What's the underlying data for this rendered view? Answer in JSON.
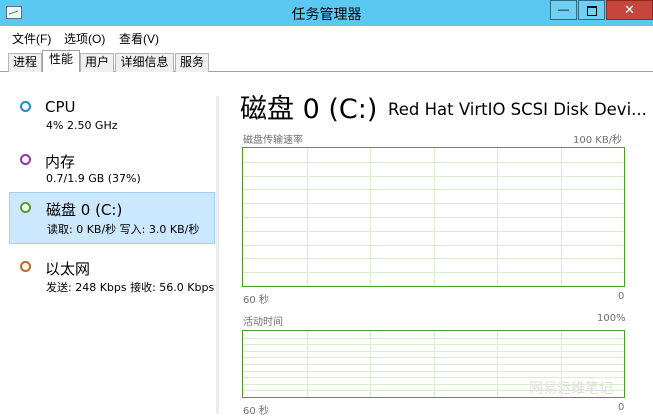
{
  "window": {
    "title": "任务管理器",
    "minimize_glyph": "—",
    "close_glyph": "✕"
  },
  "menu": [
    "文件(F)",
    "选项(O)",
    "查看(V)"
  ],
  "tabs": [
    {
      "label": "进程",
      "active": false
    },
    {
      "label": "性能",
      "active": true
    },
    {
      "label": "用户",
      "active": false
    },
    {
      "label": "详细信息",
      "active": false
    },
    {
      "label": "服务",
      "active": false
    }
  ],
  "resources": [
    {
      "name": "CPU",
      "detail": "4%  2.50 GHz",
      "color": "#1a8fd0",
      "selected": false
    },
    {
      "name": "内存",
      "detail": "0.7/1.9 GB (37%)",
      "color": "#9b2fae",
      "selected": false
    },
    {
      "name": "磁盘 0 (C:)",
      "detail": "读取: 0 KB/秒  写入: 3.0 KB/秒",
      "color": "#4d9e29",
      "selected": true
    },
    {
      "name": "以太网",
      "detail": "发送: 248 Kbps  接收: 56.0 Kbps",
      "color": "#c8651b",
      "selected": false
    }
  ],
  "detail": {
    "title": "磁盘 0 (C:)",
    "device": "Red Hat VirtIO SCSI Disk Devi...",
    "transfer_chart": {
      "label": "磁盘传输速率",
      "max_label": "100 KB/秒",
      "time_label": "60 秒",
      "min_label": "0",
      "color": "#4d9e29"
    },
    "active_chart": {
      "label": "活动时间",
      "max_label": "100%",
      "time_label": "60 秒",
      "min_label": "0",
      "color": "#4d9e29"
    }
  },
  "watermark": "网易运维笔记"
}
